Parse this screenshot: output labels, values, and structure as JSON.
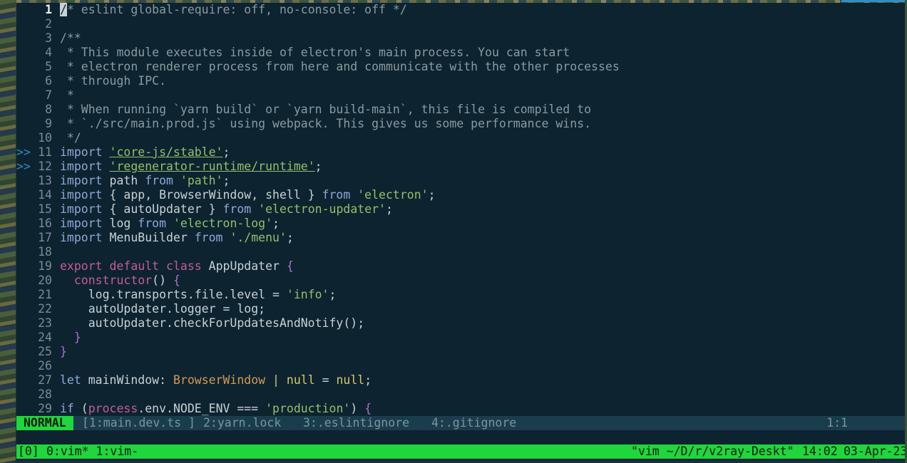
{
  "colors": {
    "background": "#0d2330",
    "mode_bg": "#1fd63c",
    "tmux_bg": "#1fd63c",
    "status_bg": "#1a3d4e"
  },
  "editor": {
    "lines": [
      {
        "n": "1",
        "sign": "",
        "text": "/* eslint global-require: off, no-console: off */"
      },
      {
        "n": "2",
        "sign": "",
        "text": ""
      },
      {
        "n": "3",
        "sign": "",
        "text": "/**"
      },
      {
        "n": "4",
        "sign": "",
        "text": " * This module executes inside of electron's main process. You can start"
      },
      {
        "n": "5",
        "sign": "",
        "text": " * electron renderer process from here and communicate with the other processes"
      },
      {
        "n": "6",
        "sign": "",
        "text": " * through IPC."
      },
      {
        "n": "7",
        "sign": "",
        "text": " *"
      },
      {
        "n": "8",
        "sign": "",
        "text": " * When running `yarn build` or `yarn build-main`, this file is compiled to"
      },
      {
        "n": "9",
        "sign": "",
        "text": " * `./src/main.prod.js` using webpack. This gives us some performance wins."
      },
      {
        "n": "10",
        "sign": "",
        "text": " */"
      },
      {
        "n": "11",
        "sign": ">>",
        "text": "import 'core-js/stable';"
      },
      {
        "n": "12",
        "sign": ">>",
        "text": "import 'regenerator-runtime/runtime';"
      },
      {
        "n": "13",
        "sign": "",
        "text": "import path from 'path';"
      },
      {
        "n": "14",
        "sign": "",
        "text": "import { app, BrowserWindow, shell } from 'electron';"
      },
      {
        "n": "15",
        "sign": "",
        "text": "import { autoUpdater } from 'electron-updater';"
      },
      {
        "n": "16",
        "sign": "",
        "text": "import log from 'electron-log';"
      },
      {
        "n": "17",
        "sign": "",
        "text": "import MenuBuilder from './menu';"
      },
      {
        "n": "18",
        "sign": "",
        "text": ""
      },
      {
        "n": "19",
        "sign": "",
        "text": "export default class AppUpdater {"
      },
      {
        "n": "20",
        "sign": "",
        "text": "  constructor() {"
      },
      {
        "n": "21",
        "sign": "",
        "text": "    log.transports.file.level = 'info';"
      },
      {
        "n": "22",
        "sign": "",
        "text": "    autoUpdater.logger = log;"
      },
      {
        "n": "23",
        "sign": "",
        "text": "    autoUpdater.checkForUpdatesAndNotify();"
      },
      {
        "n": "24",
        "sign": "",
        "text": "  }"
      },
      {
        "n": "25",
        "sign": "",
        "text": "}"
      },
      {
        "n": "26",
        "sign": "",
        "text": ""
      },
      {
        "n": "27",
        "sign": "",
        "text": "let mainWindow: BrowserWindow | null = null;"
      },
      {
        "n": "28",
        "sign": "",
        "text": ""
      },
      {
        "n": "29",
        "sign": "",
        "text": "if (process.env.NODE_ENV === 'production') {"
      }
    ]
  },
  "statusline": {
    "mode": "NORMAL",
    "buffers": [
      "[1:main.dev.ts ]",
      "2:yarn.lock",
      "3:.eslintignore",
      "4:.gitignore"
    ],
    "position": "1:1"
  },
  "tmux": {
    "session": "[0]",
    "windows": "0:vim* 1:vim-",
    "title": "\"vim ~/D/r/v2ray-Deskt\"",
    "time": "14:02",
    "date": "03-Apr-23"
  }
}
